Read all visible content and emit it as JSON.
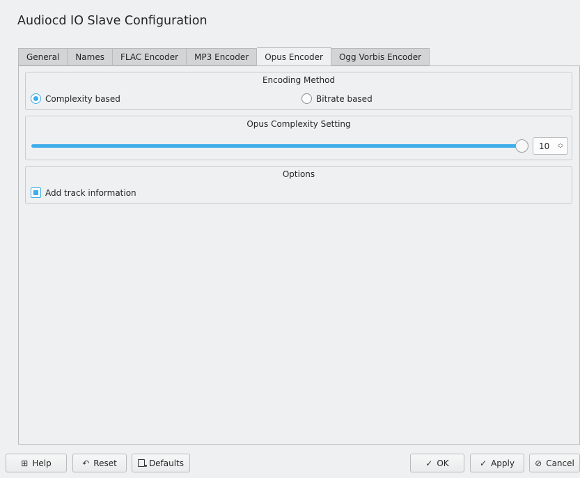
{
  "window": {
    "title": "Audiocd IO Slave Configuration"
  },
  "tabs": [
    {
      "label": "General",
      "active": false
    },
    {
      "label": "Names",
      "active": false
    },
    {
      "label": "FLAC Encoder",
      "active": false
    },
    {
      "label": "MP3 Encoder",
      "active": false
    },
    {
      "label": "Opus Encoder",
      "active": true
    },
    {
      "label": "Ogg Vorbis Encoder",
      "active": false
    }
  ],
  "encoding_method": {
    "title": "Encoding Method",
    "options": [
      {
        "label": "Complexity based",
        "checked": true
      },
      {
        "label": "Bitrate based",
        "checked": false
      }
    ]
  },
  "complexity": {
    "title": "Opus Complexity Setting",
    "value": "10",
    "min": 0,
    "max": 10,
    "accent": "#3daee9"
  },
  "options": {
    "title": "Options",
    "add_track_info": {
      "label": "Add track information",
      "checked": true
    }
  },
  "buttons": {
    "help": {
      "label": "Help",
      "icon": "help-icon"
    },
    "reset": {
      "label": "Reset",
      "icon": "undo-icon"
    },
    "defaults": {
      "label": "Defaults",
      "icon": "defaults-icon"
    },
    "ok": {
      "label": "OK",
      "icon": "check-icon"
    },
    "apply": {
      "label": "Apply",
      "icon": "check-icon"
    },
    "cancel": {
      "label": "Cancel",
      "icon": "cancel-icon"
    }
  }
}
